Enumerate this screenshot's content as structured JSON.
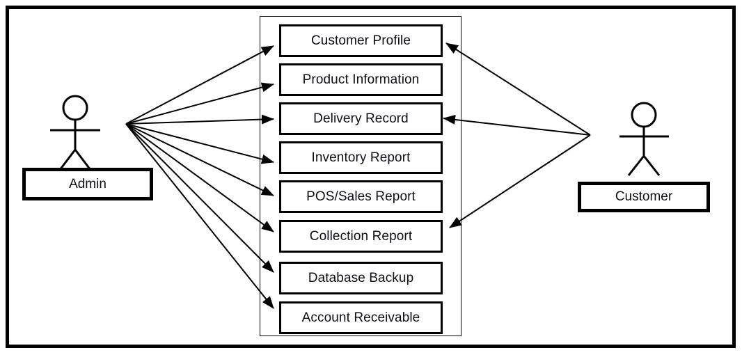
{
  "diagram": {
    "type": "uml-use-case-diagram",
    "actors": [
      {
        "id": "admin",
        "label": "Admin",
        "side": "left"
      },
      {
        "id": "customer",
        "label": "Customer",
        "side": "right"
      }
    ],
    "use_cases": [
      {
        "id": "uc1",
        "label": "Customer Profile"
      },
      {
        "id": "uc2",
        "label": "Product Information"
      },
      {
        "id": "uc3",
        "label": "Delivery Record"
      },
      {
        "id": "uc4",
        "label": "Inventory Report"
      },
      {
        "id": "uc5",
        "label": "POS/Sales Report"
      },
      {
        "id": "uc6",
        "label": "Collection Report"
      },
      {
        "id": "uc7",
        "label": "Database Backup"
      },
      {
        "id": "uc8",
        "label": "Account Receivable"
      }
    ],
    "associations": [
      {
        "from": "admin",
        "to": "uc1"
      },
      {
        "from": "admin",
        "to": "uc2"
      },
      {
        "from": "admin",
        "to": "uc3"
      },
      {
        "from": "admin",
        "to": "uc4"
      },
      {
        "from": "admin",
        "to": "uc5"
      },
      {
        "from": "admin",
        "to": "uc6"
      },
      {
        "from": "admin",
        "to": "uc7"
      },
      {
        "from": "admin",
        "to": "uc8"
      },
      {
        "from": "customer",
        "to": "uc1"
      },
      {
        "from": "customer",
        "to": "uc3"
      },
      {
        "from": "customer",
        "to": "uc6"
      }
    ],
    "colors": {
      "stroke": "#000000",
      "text": "#0d0d1a",
      "background": "#ffffff"
    }
  }
}
